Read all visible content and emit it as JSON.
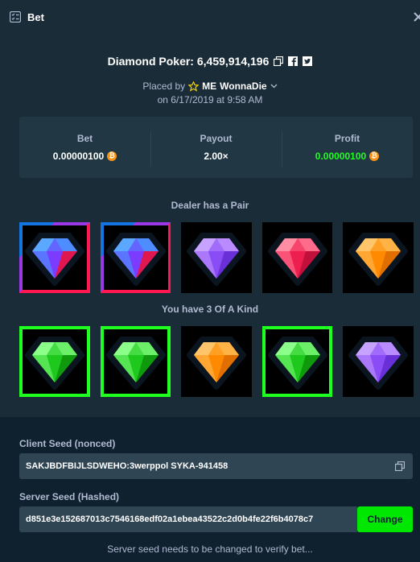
{
  "header": {
    "title": "Bet"
  },
  "bet": {
    "game_title": "Diamond Poker: 6,459,914,196",
    "placed_by_prefix": "Placed by",
    "user_rank": "ME",
    "username": "WonnaDie",
    "date_line": "on 6/17/2019 at 9:58 AM"
  },
  "stats": {
    "bet_label": "Bet",
    "bet_value": "0.00000100",
    "payout_label": "Payout",
    "payout_value": "2.00×",
    "profit_label": "Profit",
    "profit_value": "0.00000100"
  },
  "dealer": {
    "label": "Dealer has a Pair",
    "gems": [
      {
        "color": "blue",
        "pair": true
      },
      {
        "color": "blue",
        "pair": true
      },
      {
        "color": "purple",
        "pair": false
      },
      {
        "color": "red",
        "pair": false
      },
      {
        "color": "orange",
        "pair": false
      }
    ]
  },
  "player": {
    "label": "You have 3 Of A Kind",
    "gems": [
      {
        "color": "green",
        "match": true
      },
      {
        "color": "green",
        "match": true
      },
      {
        "color": "orange",
        "match": false
      },
      {
        "color": "green",
        "match": true
      },
      {
        "color": "purple",
        "match": false
      }
    ]
  },
  "seeds": {
    "client_label": "Client Seed (nonced)",
    "client_value": "SAKJBDFBIJLSDWEHO:3werppol SYKA-941458",
    "server_label": "Server Seed (Hashed)",
    "server_value": "d851e3e152687013c7546168edf02a1ebea43522c2d0b4fe22f6b4078c7",
    "change_label": "Change",
    "note": "Server seed needs to be changed to verify bet..."
  },
  "colors": {
    "accent_green": "#1fff20",
    "button_green": "#00e701",
    "bitcoin": "#f7931a",
    "gem_blue": "#8f4cff",
    "gem_purple": "#9b5cff",
    "gem_red": "#ff1752",
    "gem_orange": "#ff9a00",
    "gem_green": "#24d11f"
  }
}
